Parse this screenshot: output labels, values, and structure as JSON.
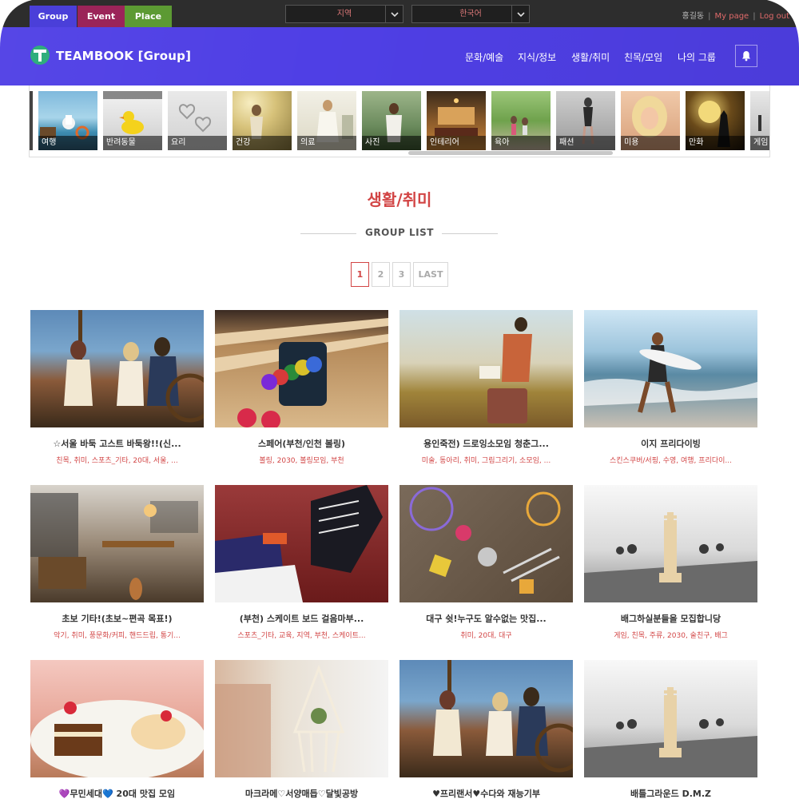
{
  "topbar": {
    "tabs": [
      "Group",
      "Event",
      "Place"
    ],
    "region_select": "지역",
    "language_select": "한국어",
    "user_name": "홍길동",
    "my_page": "My page",
    "logout": "Log out"
  },
  "header": {
    "logo_text": "TEAMBOOK [Group]",
    "nav": [
      "문화/예술",
      "지식/정보",
      "생활/취미",
      "친목/모임",
      "나의 그룹"
    ]
  },
  "categories": [
    "여행",
    "반려동물",
    "요리",
    "건강",
    "의료",
    "사진",
    "인테리어",
    "육아",
    "패션",
    "미용",
    "만화",
    "게임"
  ],
  "section": {
    "title": "생활/취미",
    "subtitle": "GROUP LIST"
  },
  "pagination": [
    "1",
    "2",
    "3",
    "LAST"
  ],
  "cards": [
    {
      "name": "☆서울 바둑 고스트 바둑왕!!(신...",
      "tags": "친목, 취미, 스포츠_기타, 20대, 서울, ..."
    },
    {
      "name": "스페어(부천/인천 볼링)",
      "tags": "볼링, 2030, 볼링모임, 부천"
    },
    {
      "name": "용인죽전) 드로잉소모임 청춘그...",
      "tags": "미술, 동아리, 취미, 그림그리기, 소모임, ..."
    },
    {
      "name": "이지 프리다이빙",
      "tags": "스킨스쿠버/서핑, 수영, 여행, 프리다이..."
    },
    {
      "name": "초보 기타!(초보~편곡 목표!)",
      "tags": "악기, 취미, 풍문화/커피, 핸드드립, 통기..."
    },
    {
      "name": "(부천) 스케이트 보드 걸음마부...",
      "tags": "스포츠_기타, 교육, 지역, 부천, 스케이트..."
    },
    {
      "name": "대구 쉿!누구도 알수없는 맛집...",
      "tags": "취미, 20대, 대구"
    },
    {
      "name": "배그하실분들을 모집합니당",
      "tags": "게임, 친목, 주류, 2030, 술친구, 배그"
    },
    {
      "name": "💜무민세대💙 20대 맛집 모임",
      "tags": ""
    },
    {
      "name": "마크라메♡서양매듭♡달빛공방",
      "tags": ""
    },
    {
      "name": "♥프리랜서♥수다와 재능기부",
      "tags": ""
    },
    {
      "name": "배틀그라운드 D.M.Z",
      "tags": ""
    }
  ]
}
